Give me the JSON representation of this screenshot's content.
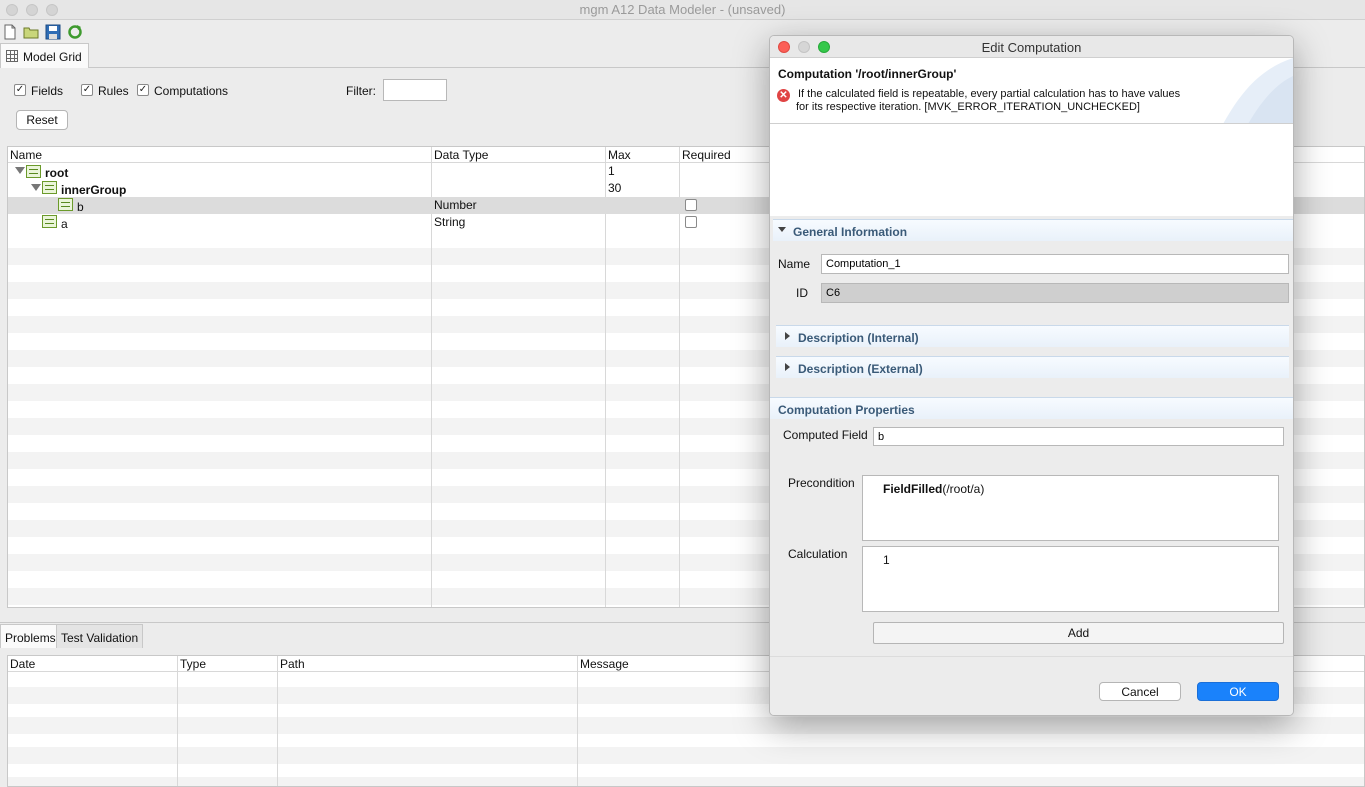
{
  "window": {
    "title": "mgm A12 Data Modeler - (unsaved)"
  },
  "toolbar": {
    "icons": [
      "new-file-icon",
      "open-folder-icon",
      "save-icon",
      "refresh-icon"
    ]
  },
  "view_tab": {
    "label": "Model Grid"
  },
  "filters": {
    "fields_label": "Fields",
    "fields_checked": true,
    "rules_label": "Rules",
    "rules_checked": true,
    "computations_label": "Computations",
    "computations_checked": true,
    "filter_label": "Filter:",
    "filter_value": "",
    "reset_label": "Reset"
  },
  "grid": {
    "headers": {
      "name": "Name",
      "data_type": "Data Type",
      "max": "Max",
      "required": "Required"
    },
    "rows": [
      {
        "name": "root",
        "data_type": "",
        "max": "1"
      },
      {
        "name": "innerGroup",
        "data_type": "",
        "max": "30"
      },
      {
        "name": "b",
        "data_type": "Number",
        "max": ""
      },
      {
        "name": "a",
        "data_type": "String",
        "max": ""
      }
    ]
  },
  "bottom": {
    "tabs": [
      "Problems",
      "Test Validation"
    ],
    "headers": {
      "date": "Date",
      "type": "Type",
      "path": "Path",
      "message": "Message"
    }
  },
  "dialog": {
    "title": "Edit Computation",
    "heading": "Computation '/root/innerGroup'",
    "error_line1": "If the calculated field is repeatable, every partial calculation has to have values",
    "error_line2": "for its respective iteration. [MVK_ERROR_ITERATION_UNCHECKED]",
    "general_section": "General Information",
    "name_label": "Name",
    "name_value": "Computation_1",
    "id_label": "ID",
    "id_value": "C6",
    "desc_internal": "Description (Internal)",
    "desc_external": "Description (External)",
    "props_section": "Computation Properties",
    "computed_field_label": "Computed Field",
    "computed_field_value": "b",
    "precondition_label": "Precondition",
    "precondition_func": "FieldFilled",
    "precondition_arg": "(/root/a)",
    "calculation_label": "Calculation",
    "calculation_value": "1",
    "add_label": "Add",
    "cancel_label": "Cancel",
    "ok_label": "OK",
    "accent": "#1a82fb"
  }
}
